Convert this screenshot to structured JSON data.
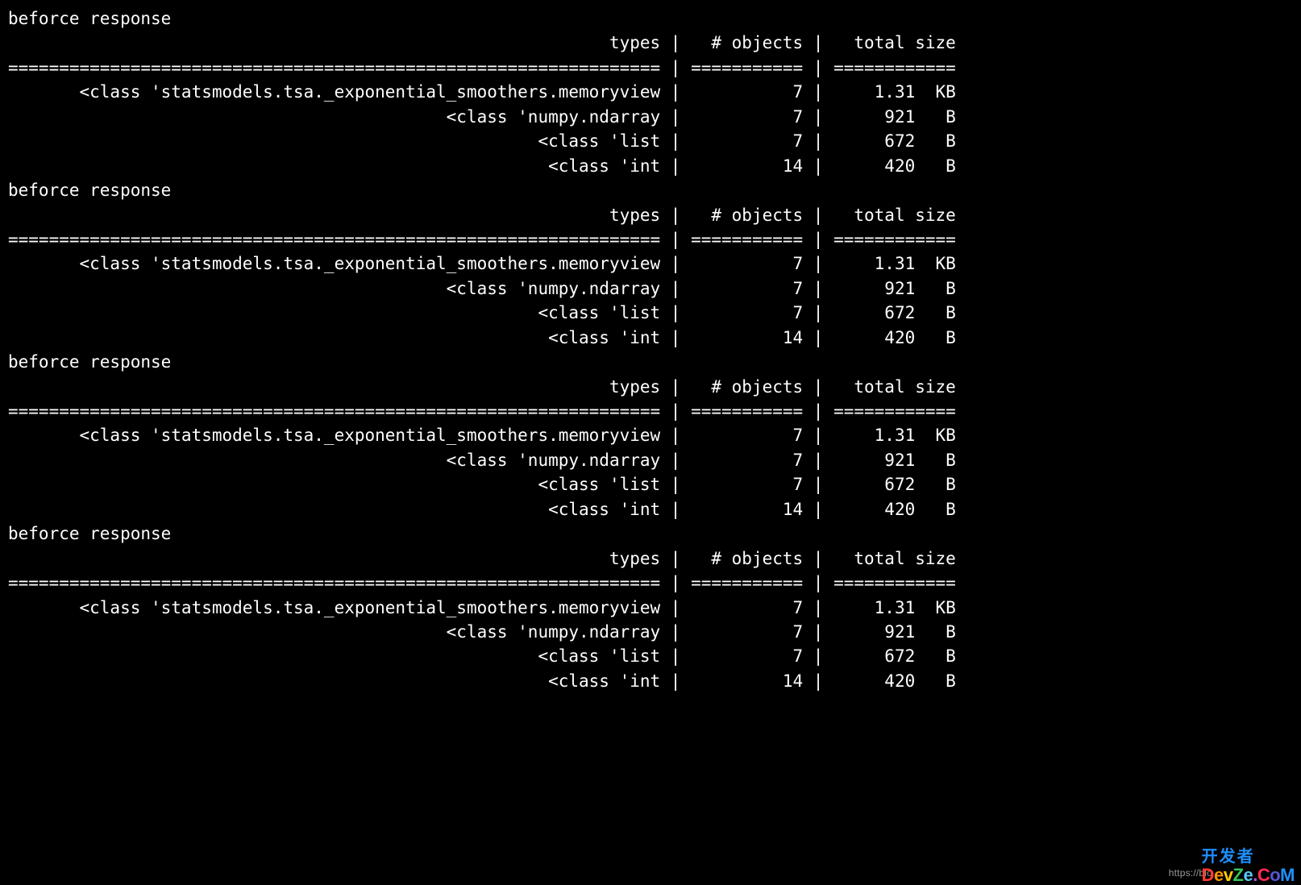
{
  "layout": {
    "types_col_chars": 64,
    "objects_col_chars": 11,
    "size_col_chars": 12
  },
  "labels": {
    "before_response": "beforce response",
    "header_types": "types",
    "header_objects": "# objects",
    "header_size": "total size",
    "separator": " | "
  },
  "blocks": [
    {
      "rows": [
        {
          "type": "<class 'statsmodels.tsa._exponential_smoothers.memoryview",
          "objects": "7",
          "size_num": "1.31",
          "size_unit": "KB"
        },
        {
          "type": "<class 'numpy.ndarray",
          "objects": "7",
          "size_num": "921",
          "size_unit": "B"
        },
        {
          "type": "<class 'list",
          "objects": "7",
          "size_num": "672",
          "size_unit": "B"
        },
        {
          "type": "<class 'int",
          "objects": "14",
          "size_num": "420",
          "size_unit": "B"
        }
      ]
    },
    {
      "rows": [
        {
          "type": "<class 'statsmodels.tsa._exponential_smoothers.memoryview",
          "objects": "7",
          "size_num": "1.31",
          "size_unit": "KB"
        },
        {
          "type": "<class 'numpy.ndarray",
          "objects": "7",
          "size_num": "921",
          "size_unit": "B"
        },
        {
          "type": "<class 'list",
          "objects": "7",
          "size_num": "672",
          "size_unit": "B"
        },
        {
          "type": "<class 'int",
          "objects": "14",
          "size_num": "420",
          "size_unit": "B"
        }
      ]
    },
    {
      "rows": [
        {
          "type": "<class 'statsmodels.tsa._exponential_smoothers.memoryview",
          "objects": "7",
          "size_num": "1.31",
          "size_unit": "KB"
        },
        {
          "type": "<class 'numpy.ndarray",
          "objects": "7",
          "size_num": "921",
          "size_unit": "B"
        },
        {
          "type": "<class 'list",
          "objects": "7",
          "size_num": "672",
          "size_unit": "B"
        },
        {
          "type": "<class 'int",
          "objects": "14",
          "size_num": "420",
          "size_unit": "B"
        }
      ]
    },
    {
      "rows": [
        {
          "type": "<class 'statsmodels.tsa._exponential_smoothers.memoryview",
          "objects": "7",
          "size_num": "1.31",
          "size_unit": "KB"
        },
        {
          "type": "<class 'numpy.ndarray",
          "objects": "7",
          "size_num": "921",
          "size_unit": "B"
        },
        {
          "type": "<class 'list",
          "objects": "7",
          "size_num": "672",
          "size_unit": "B"
        },
        {
          "type": "<class 'int",
          "objects": "14",
          "size_num": "420",
          "size_unit": "B"
        }
      ]
    }
  ],
  "watermark": {
    "link_prefix": "https://blo",
    "logo_zh": "开发者",
    "logo_en": "DevZe.CoM"
  }
}
